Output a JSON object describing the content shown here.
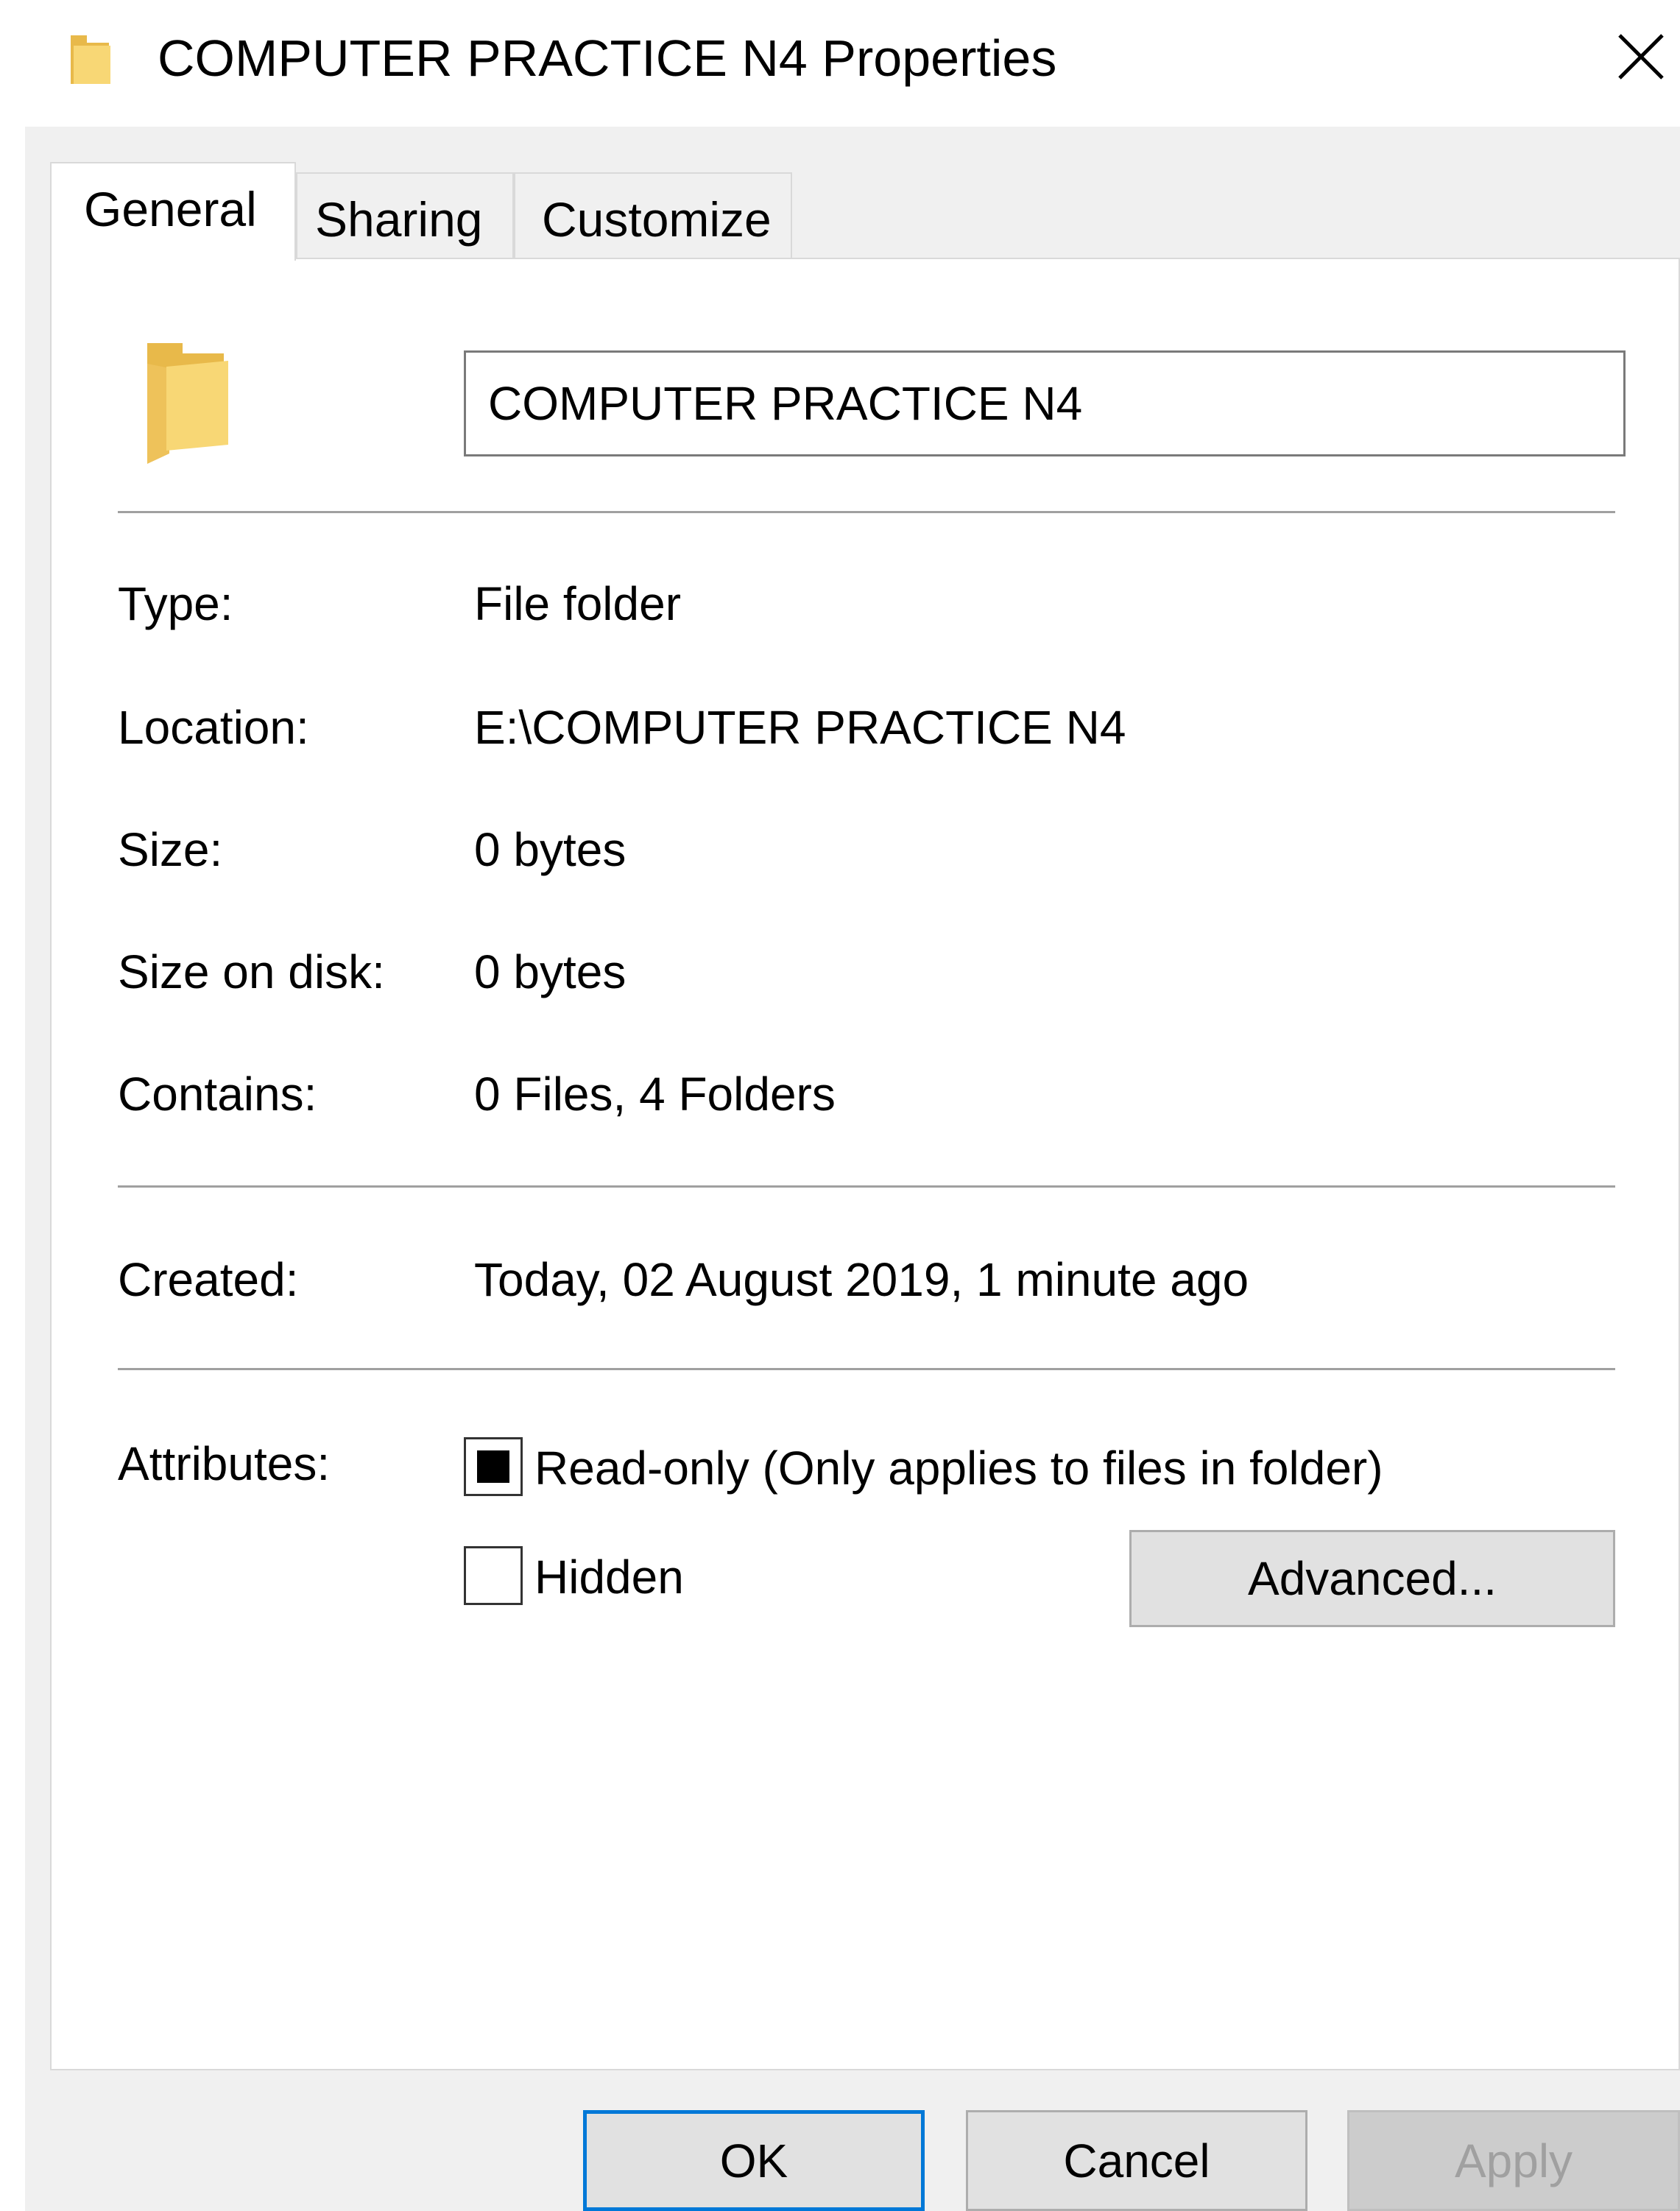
{
  "window": {
    "title": "COMPUTER PRACTICE N4 Properties",
    "title_icon": "folder-icon",
    "close_icon": "close-icon"
  },
  "tabs": [
    {
      "label": "General",
      "active": true
    },
    {
      "label": "Sharing",
      "active": false
    },
    {
      "label": "Customize",
      "active": false
    }
  ],
  "general": {
    "folder_icon": "folder-icon",
    "name_value": "COMPUTER PRACTICE N4",
    "properties": [
      {
        "label": "Type:",
        "value": "File folder"
      },
      {
        "label": "Location:",
        "value": "E:\\COMPUTER PRACTICE N4"
      },
      {
        "label": "Size:",
        "value": "0 bytes"
      },
      {
        "label": "Size on disk:",
        "value": "0 bytes"
      },
      {
        "label": "Contains:",
        "value": "0 Files, 4 Folders"
      }
    ],
    "created": {
      "label": "Created:",
      "value": "Today, 02 August 2019, 1 minute ago"
    },
    "attributes": {
      "label": "Attributes:",
      "readonly": {
        "label": "Read-only (Only applies to files in folder)",
        "state": "indeterminate"
      },
      "hidden": {
        "label": "Hidden",
        "state": "unchecked"
      },
      "advanced_label": "Advanced..."
    }
  },
  "footer": {
    "ok_label": "OK",
    "cancel_label": "Cancel",
    "apply_label": "Apply",
    "apply_enabled": false
  },
  "colors": {
    "folder_yellow": "#f8d775",
    "folder_shade": "#e8b94a",
    "focus_blue": "#0078d7",
    "dialog_gray": "#f0f0f0"
  }
}
